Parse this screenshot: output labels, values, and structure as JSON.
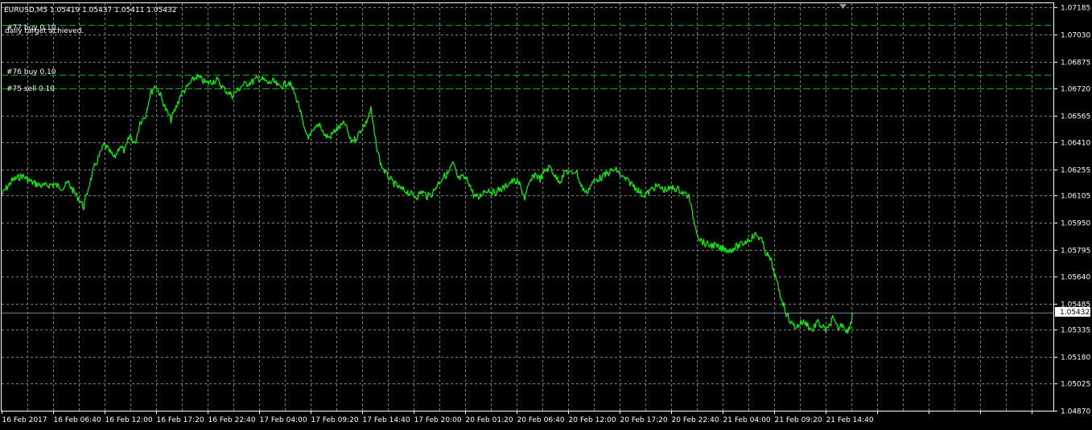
{
  "window": {
    "symbol_info": "EURUSD,M5  1.05419 1.05437 1.05411 1.05432"
  },
  "order_labels": [
    {
      "text": "#77 buy 0.10",
      "price": 1.07085
    },
    {
      "text": "daily target achieved.",
      "price": null
    },
    {
      "text": "#76 buy 0.10",
      "price": 1.068
    },
    {
      "text": "#75 sell 0.10",
      "price": 1.0672
    }
  ],
  "colors": {
    "background": "#000000",
    "grid": "#7f7f7f",
    "price_line": "#00ff00",
    "order_line": "#00b000",
    "bid_line": "#5f7f8f",
    "axis": "#ffffff",
    "current_price_box": "#ffffff"
  },
  "current_price": "1.05432",
  "chart_data": {
    "type": "line",
    "symbol": "EURUSD",
    "timeframe": "M5",
    "ylim": [
      1.0487,
      1.0721
    ],
    "y_ticks": [
      "1.07185",
      "1.07030",
      "1.06875",
      "1.06720",
      "1.06565",
      "1.06410",
      "1.06255",
      "1.06105",
      "1.05950",
      "1.05795",
      "1.05640",
      "1.05485",
      "1.05335",
      "1.05180",
      "1.05025",
      "1.04870"
    ],
    "x_ticks": [
      "16 Feb 2017",
      "16 Feb 06:40",
      "16 Feb 12:00",
      "16 Feb 17:20",
      "16 Feb 22:40",
      "17 Feb 04:00",
      "17 Feb 09:20",
      "17 Feb 14:40",
      "17 Feb 20:00",
      "20 Feb 01:20",
      "20 Feb 06:40",
      "20 Feb 12:00",
      "20 Feb 17:20",
      "20 Feb 22:40",
      "21 Feb 04:00",
      "21 Feb 09:20",
      "21 Feb 14:40"
    ],
    "grid": true,
    "series": [
      {
        "points": [
          [
            0,
            1.0611
          ],
          [
            2,
            1.0619
          ],
          [
            4,
            1.0622
          ],
          [
            6,
            1.0618
          ],
          [
            8,
            1.0616
          ],
          [
            10,
            1.0617
          ],
          [
            12,
            1.0615
          ],
          [
            13,
            1.0618
          ],
          [
            14,
            1.0613
          ],
          [
            15,
            1.0609
          ],
          [
            16,
            1.0604
          ],
          [
            17,
            1.0616
          ],
          [
            18,
            1.0626
          ],
          [
            19,
            1.0633
          ],
          [
            20,
            1.064
          ],
          [
            21,
            1.0636
          ],
          [
            22,
            1.0632
          ],
          [
            23,
            1.0639
          ],
          [
            24,
            1.0636
          ],
          [
            25,
            1.0645
          ],
          [
            26,
            1.064
          ],
          [
            27,
            1.0653
          ],
          [
            28,
            1.0656
          ],
          [
            29,
            1.0669
          ],
          [
            30,
            1.0674
          ],
          [
            31,
            1.0668
          ],
          [
            32,
            1.066
          ],
          [
            33,
            1.0654
          ],
          [
            34,
            1.0661
          ],
          [
            35,
            1.0669
          ],
          [
            36,
            1.0672
          ],
          [
            37,
            1.0676
          ],
          [
            38,
            1.0679
          ],
          [
            39,
            1.0677
          ],
          [
            40,
            1.0675
          ],
          [
            41,
            1.0676
          ],
          [
            42,
            1.0677
          ],
          [
            43,
            1.0673
          ],
          [
            44,
            1.067
          ],
          [
            45,
            1.0668
          ],
          [
            46,
            1.0671
          ],
          [
            47,
            1.0674
          ],
          [
            48,
            1.0675
          ],
          [
            49,
            1.0676
          ],
          [
            50,
            1.0678
          ],
          [
            51,
            1.0677
          ],
          [
            52,
            1.0675
          ],
          [
            53,
            1.0676
          ],
          [
            54,
            1.0673
          ],
          [
            55,
            1.0674
          ],
          [
            56,
            1.0676
          ],
          [
            57,
            1.067
          ],
          [
            58,
            1.0662
          ],
          [
            59,
            1.0648
          ],
          [
            60,
            1.0644
          ],
          [
            61,
            1.0648
          ],
          [
            62,
            1.0652
          ],
          [
            63,
            1.0645
          ],
          [
            64,
            1.0644
          ],
          [
            65,
            1.0648
          ],
          [
            66,
            1.065
          ],
          [
            67,
            1.0652
          ],
          [
            68,
            1.0642
          ],
          [
            69,
            1.0643
          ],
          [
            70,
            1.0648
          ],
          [
            71,
            1.0652
          ],
          [
            72,
            1.066
          ],
          [
            73,
            1.064
          ],
          [
            74,
            1.0628
          ],
          [
            75,
            1.0623
          ],
          [
            76,
            1.0619
          ],
          [
            77,
            1.0616
          ],
          [
            78,
            1.0614
          ],
          [
            79,
            1.0613
          ],
          [
            80,
            1.0611
          ],
          [
            81,
            1.061
          ],
          [
            82,
            1.0613
          ],
          [
            83,
            1.061
          ],
          [
            84,
            1.0612
          ],
          [
            85,
            1.0617
          ],
          [
            86,
            1.0621
          ],
          [
            87,
            1.0623
          ],
          [
            88,
            1.0629
          ],
          [
            89,
            1.062
          ],
          [
            90,
            1.0621
          ],
          [
            91,
            1.0619
          ],
          [
            92,
            1.0611
          ],
          [
            93,
            1.0609
          ],
          [
            94,
            1.0613
          ],
          [
            95,
            1.0614
          ],
          [
            96,
            1.0612
          ],
          [
            97,
            1.0614
          ],
          [
            98,
            1.0615
          ],
          [
            99,
            1.0618
          ],
          [
            100,
            1.0619
          ],
          [
            101,
            1.0617
          ],
          [
            102,
            1.0609
          ],
          [
            103,
            1.0618
          ],
          [
            104,
            1.0623
          ],
          [
            105,
            1.062
          ],
          [
            106,
            1.0625
          ],
          [
            107,
            1.0627
          ],
          [
            108,
            1.0621
          ],
          [
            109,
            1.0619
          ],
          [
            110,
            1.0625
          ],
          [
            111,
            1.0623
          ],
          [
            112,
            1.0625
          ],
          [
            113,
            1.0616
          ],
          [
            114,
            1.0612
          ],
          [
            115,
            1.0617
          ],
          [
            116,
            1.062
          ],
          [
            117,
            1.0621
          ],
          [
            118,
            1.0623
          ],
          [
            119,
            1.0625
          ],
          [
            120,
            1.0625
          ],
          [
            121,
            1.0621
          ],
          [
            122,
            1.0619
          ],
          [
            123,
            1.0617
          ],
          [
            124,
            1.0614
          ],
          [
            125,
            1.0611
          ],
          [
            126,
            1.0612
          ],
          [
            127,
            1.0615
          ],
          [
            128,
            1.0616
          ],
          [
            129,
            1.0614
          ],
          [
            130,
            1.0614
          ],
          [
            131,
            1.0615
          ],
          [
            132,
            1.0614
          ],
          [
            133,
            1.0612
          ],
          [
            134,
            1.061
          ],
          [
            135,
            1.0596
          ],
          [
            136,
            1.0586
          ],
          [
            137,
            1.0583
          ],
          [
            138,
            1.0582
          ],
          [
            139,
            1.0582
          ],
          [
            140,
            1.058
          ],
          [
            141,
            1.058
          ],
          [
            142,
            1.0579
          ],
          [
            143,
            1.0581
          ],
          [
            144,
            1.0582
          ],
          [
            145,
            1.0584
          ],
          [
            146,
            1.0586
          ],
          [
            147,
            1.0588
          ],
          [
            148,
            1.0586
          ],
          [
            149,
            1.0578
          ],
          [
            150,
            1.0573
          ],
          [
            151,
            1.0562
          ],
          [
            152,
            1.0552
          ],
          [
            153,
            1.0543
          ],
          [
            154,
            1.0537
          ],
          [
            155,
            1.0535
          ],
          [
            156,
            1.0538
          ],
          [
            157,
            1.0537
          ],
          [
            158,
            1.0533
          ],
          [
            159,
            1.0538
          ],
          [
            160,
            1.0535
          ],
          [
            161,
            1.0533
          ],
          [
            162,
            1.054
          ],
          [
            163,
            1.0534
          ],
          [
            164,
            1.0537
          ],
          [
            165,
            1.0532
          ],
          [
            166,
            1.0543
          ]
        ]
      }
    ]
  }
}
